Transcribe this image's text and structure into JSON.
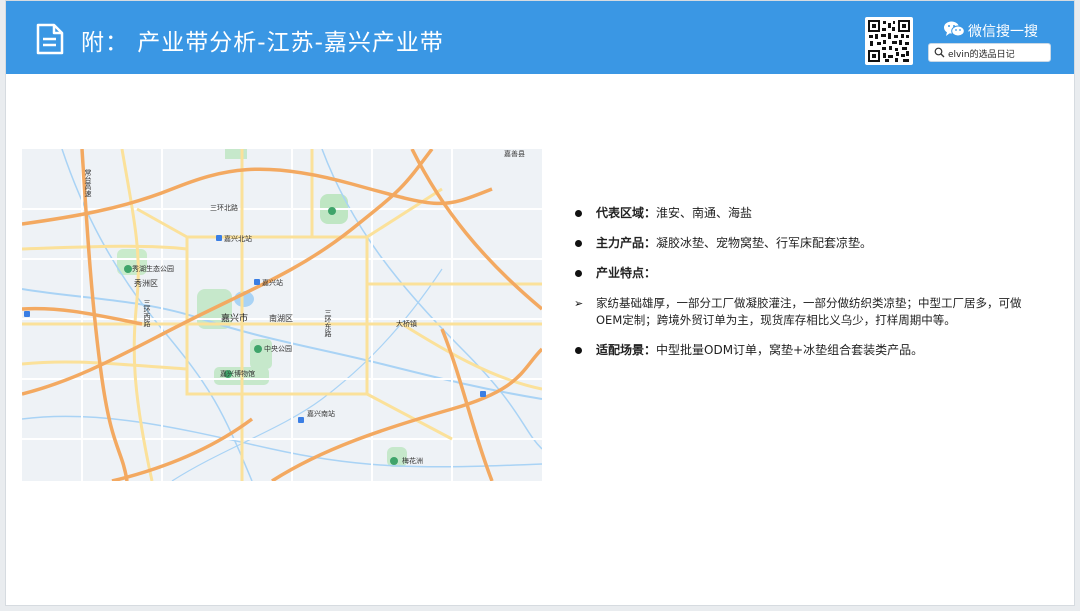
{
  "header": {
    "title": "附：  产业带分析-江苏-嘉兴产业带",
    "wechat_label": "微信搜一搜",
    "search_text": "elvin的选品日记",
    "background_color": "#3a97e4"
  },
  "map": {
    "labels": {
      "jiaxing": "嘉兴市",
      "xiuzhou": "秀洲区",
      "nanhu": "南湖区",
      "sanhuan_north": "三环北路",
      "sanhuan_east": "三环东路",
      "sanhuan_west": "三环西路",
      "jiaxing_south_station": "嘉兴南站",
      "jiaxing_north_station": "嘉兴北站",
      "jiaxing_station": "嘉兴站",
      "zhongxin_park": "中央公园",
      "jiaxing_museum": "嘉兴博物馆",
      "meihuazhou": "梅花洲",
      "daqiao": "大桥镇",
      "jiahe": "嘉善县",
      "xiuhu": "秀湖生态公园",
      "changxing": "常台高速"
    }
  },
  "content": {
    "items": [
      {
        "type": "dot",
        "label": "代表区域：",
        "text": "淮安、南通、海盐"
      },
      {
        "type": "dot",
        "label": "主力产品：",
        "text": "凝胶冰垫、宠物窝垫、行军床配套凉垫。"
      },
      {
        "type": "dot",
        "label": "产业特点：",
        "text": ""
      },
      {
        "type": "arrow",
        "label": "",
        "text": "家纺基础雄厚，一部分工厂做凝胶灌注，一部分做纺织类凉垫；中型工厂居多，可做OEM定制；跨境外贸订单为主，现货库存相比义乌少，打样周期中等。"
      },
      {
        "type": "dot",
        "label": "适配场景：",
        "text": "中型批量ODM订单，窝垫+冰垫组合套装类产品。"
      }
    ]
  }
}
